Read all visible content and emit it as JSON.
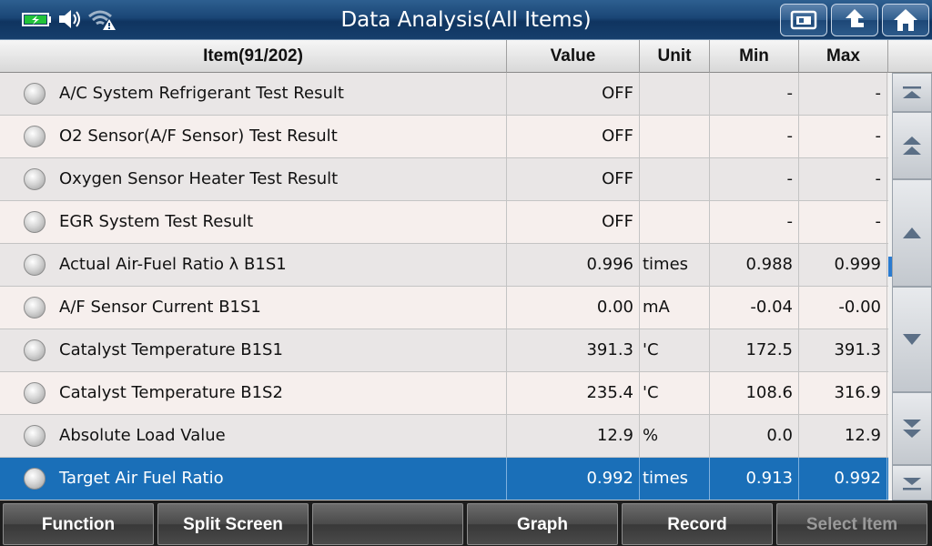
{
  "header": {
    "title": "Data Analysis(All Items)",
    "status_icons": [
      "battery-charging-icon",
      "speaker-icon",
      "wifi-warning-icon"
    ],
    "nav_buttons": [
      "screenshot-icon",
      "back-icon",
      "home-icon"
    ]
  },
  "table": {
    "columns": {
      "item": "Item(91/202)",
      "value": "Value",
      "unit": "Unit",
      "min": "Min",
      "max": "Max"
    },
    "rows": [
      {
        "item": "A/C System Refrigerant Test Result",
        "value": "OFF",
        "unit": "",
        "min": "-",
        "max": "-"
      },
      {
        "item": "O2 Sensor(A/F Sensor) Test Result",
        "value": "OFF",
        "unit": "",
        "min": "-",
        "max": "-"
      },
      {
        "item": "Oxygen Sensor Heater Test Result",
        "value": "OFF",
        "unit": "",
        "min": "-",
        "max": "-"
      },
      {
        "item": "EGR System Test Result",
        "value": "OFF",
        "unit": "",
        "min": "-",
        "max": "-"
      },
      {
        "item": "Actual Air-Fuel Ratio λ B1S1",
        "value": "0.996",
        "unit": "times",
        "min": "0.988",
        "max": "0.999"
      },
      {
        "item": "A/F Sensor Current B1S1",
        "value": "0.00",
        "unit": "mA",
        "min": "-0.04",
        "max": "-0.00"
      },
      {
        "item": "Catalyst Temperature B1S1",
        "value": "391.3",
        "unit": "'C",
        "min": "172.5",
        "max": "391.3"
      },
      {
        "item": "Catalyst Temperature B1S2",
        "value": "235.4",
        "unit": "'C",
        "min": "108.6",
        "max": "316.9"
      },
      {
        "item": "Absolute Load Value",
        "value": "12.9",
        "unit": "%",
        "min": "0.0",
        "max": "12.9"
      },
      {
        "item": "Target Air Fuel Ratio",
        "value": "0.992",
        "unit": "times",
        "min": "0.913",
        "max": "0.992"
      }
    ],
    "selected_row_index": 9
  },
  "scroll": {
    "buttons": [
      "scroll-top-icon",
      "page-up-icon",
      "line-up-icon",
      "line-down-icon",
      "page-down-icon",
      "scroll-bottom-icon"
    ],
    "position_fraction": 0.45
  },
  "footer": {
    "function": "Function",
    "split_screen": "Split Screen",
    "blank": "",
    "graph": "Graph",
    "record": "Record",
    "select_item": "Select Item"
  },
  "colors": {
    "titlebar": "#1a4676",
    "selected_row": "#1a6fb8",
    "footer_bg": "#1d1d1d"
  }
}
